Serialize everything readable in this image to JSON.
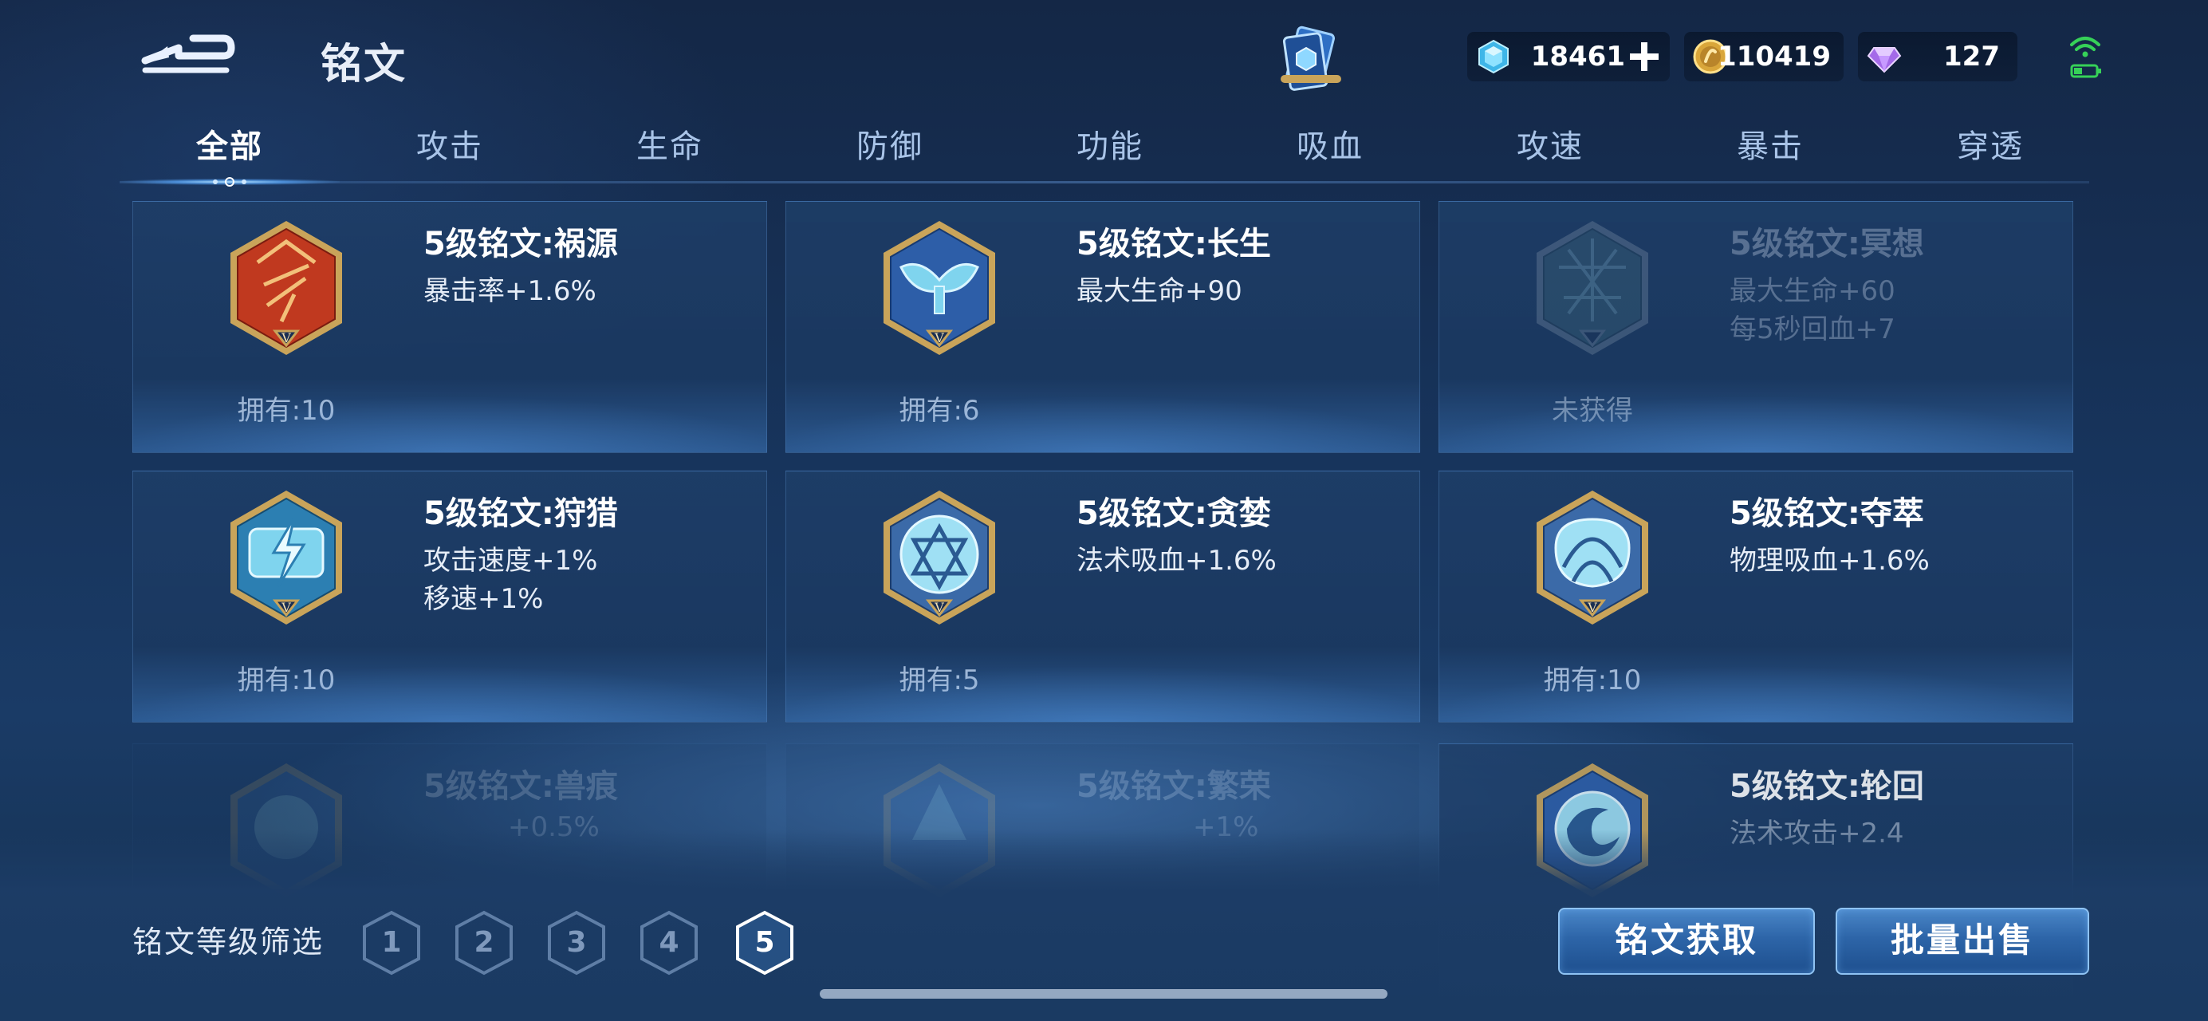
{
  "header": {
    "title": "铭文",
    "back_icon": "back-arrow-icon",
    "card_icon": "rune-book-icon",
    "currencies": {
      "diamond": "18461",
      "coin": "110419",
      "gem": "127"
    }
  },
  "tabs": [
    {
      "label": "全部",
      "active": true
    },
    {
      "label": "攻击"
    },
    {
      "label": "生命"
    },
    {
      "label": "防御"
    },
    {
      "label": "功能"
    },
    {
      "label": "吸血"
    },
    {
      "label": "攻速"
    },
    {
      "label": "暴击"
    },
    {
      "label": "穿透"
    }
  ],
  "runes": [
    {
      "name": "5级铭文:祸源",
      "stats": [
        "暴击率+1.6%"
      ],
      "owned": "拥有:10",
      "color": "red"
    },
    {
      "name": "5级铭文:长生",
      "stats": [
        "最大生命+90"
      ],
      "owned": "拥有:6",
      "color": "blue"
    },
    {
      "name": "5级铭文:冥想",
      "stats": [
        "最大生命+60",
        "每5秒回血+7"
      ],
      "owned": "未获得",
      "color": "teal",
      "locked": true
    },
    {
      "name": "5级铭文:狩猎",
      "stats": [
        "攻击速度+1%",
        "移速+1%"
      ],
      "owned": "拥有:10",
      "color": "cyan"
    },
    {
      "name": "5级铭文:贪婪",
      "stats": [
        "法术吸血+1.6%"
      ],
      "owned": "拥有:5",
      "color": "cyan"
    },
    {
      "name": "5级铭文:夺萃",
      "stats": [
        "物理吸血+1.6%"
      ],
      "owned": "拥有:10",
      "color": "cyan"
    },
    {
      "name": "5级铭文:兽痕",
      "stats": [
        "+0.5%"
      ],
      "owned": "",
      "color": "cyan"
    },
    {
      "name": "5级铭文:繁荣",
      "stats": [
        "+1%"
      ],
      "owned": "",
      "color": "cyan"
    },
    {
      "name": "5级铭文:轮回",
      "stats": [
        "法术攻击+2.4"
      ],
      "owned": "",
      "color": "cyan"
    }
  ],
  "filter": {
    "label": "铭文等级筛选",
    "levels": [
      "1",
      "2",
      "3",
      "4",
      "5"
    ],
    "selected": "5"
  },
  "buttons": {
    "get": "铭文获取",
    "sell": "批量出售"
  },
  "colors": {
    "background": "#17345c",
    "button": "#2d65a8",
    "gold": "#c9a45a",
    "red_rune": "#c0391f",
    "blue_rune": "#4a8fd0",
    "cyan_rune": "#7fd4ee"
  }
}
